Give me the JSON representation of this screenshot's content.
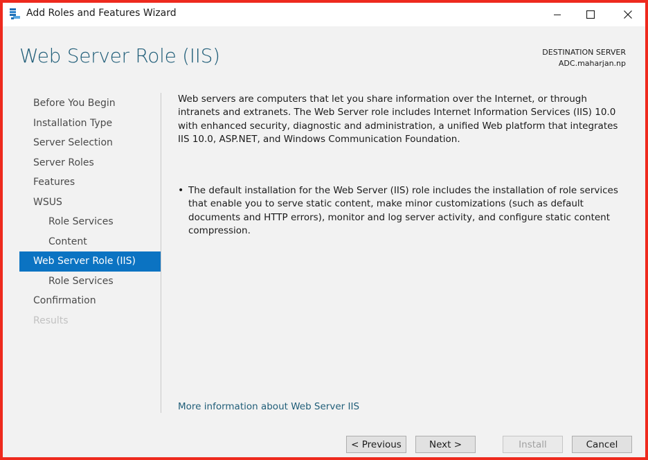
{
  "window": {
    "title": "Add Roles and Features Wizard",
    "icon": "server-manager-icon",
    "controls": [
      "minimize-icon",
      "maximize-icon",
      "close-icon"
    ]
  },
  "header": {
    "page_title": "Web Server Role (IIS)",
    "destination_label": "DESTINATION SERVER",
    "destination_server": "ADC.maharjan.np"
  },
  "nav": {
    "items": [
      {
        "label": "Before You Begin",
        "level": 0,
        "state": "normal"
      },
      {
        "label": "Installation Type",
        "level": 0,
        "state": "normal"
      },
      {
        "label": "Server Selection",
        "level": 0,
        "state": "normal"
      },
      {
        "label": "Server Roles",
        "level": 0,
        "state": "normal"
      },
      {
        "label": "Features",
        "level": 0,
        "state": "normal"
      },
      {
        "label": "WSUS",
        "level": 0,
        "state": "normal"
      },
      {
        "label": "Role Services",
        "level": 1,
        "state": "normal"
      },
      {
        "label": "Content",
        "level": 1,
        "state": "normal"
      },
      {
        "label": "Web Server Role (IIS)",
        "level": 0,
        "state": "active"
      },
      {
        "label": "Role Services",
        "level": 1,
        "state": "normal"
      },
      {
        "label": "Confirmation",
        "level": 0,
        "state": "normal"
      },
      {
        "label": "Results",
        "level": 0,
        "state": "disabled"
      }
    ]
  },
  "main": {
    "description": "Web servers are computers that let you share information over the Internet, or through intranets and extranets. The Web Server role includes Internet Information Services (IIS) 10.0 with enhanced security, diagnostic and administration, a unified Web platform that integrates IIS 10.0, ASP.NET, and Windows Communication Foundation.",
    "bullet": "The default installation for the Web Server (IIS) role includes the installation of role services that enable you to serve static content, make minor customizations (such as default documents and HTTP errors), monitor and log server activity, and configure static content compression.",
    "more_info_link": "More information about Web Server IIS"
  },
  "footer": {
    "previous_label": "< Previous",
    "next_label": "Next >",
    "install_label": "Install",
    "cancel_label": "Cancel"
  },
  "colors": {
    "accent": "#0b73c2",
    "title": "#1f5d78",
    "frame_border": "#ee2a1e",
    "panel_bg": "#f2f2f2"
  }
}
